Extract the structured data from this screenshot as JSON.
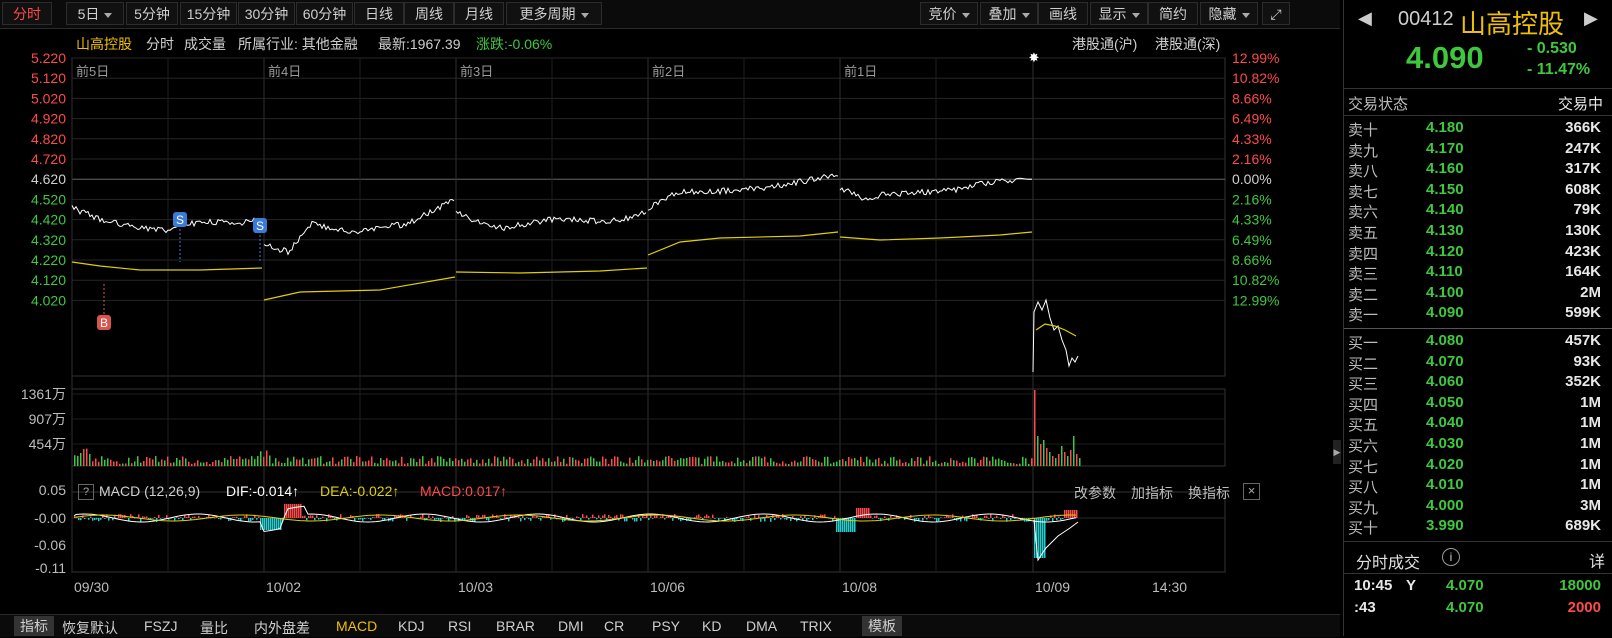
{
  "toolbar": {
    "tabs": [
      {
        "label": "分时",
        "active": true,
        "dropdown": false
      },
      {
        "label": "5日",
        "active": false,
        "dropdown": true
      },
      {
        "label": "5分钟",
        "active": false,
        "dropdown": false
      },
      {
        "label": "15分钟",
        "active": false,
        "dropdown": false
      },
      {
        "label": "30分钟",
        "active": false,
        "dropdown": false
      },
      {
        "label": "60分钟",
        "active": false,
        "dropdown": false
      },
      {
        "label": "日线",
        "active": false,
        "dropdown": false
      },
      {
        "label": "周线",
        "active": false,
        "dropdown": false
      },
      {
        "label": "月线",
        "active": false,
        "dropdown": false
      },
      {
        "label": "更多周期",
        "active": false,
        "dropdown": true
      }
    ],
    "right_buttons": [
      {
        "label": "竞价",
        "dropdown": true
      },
      {
        "label": "叠加",
        "dropdown": true
      },
      {
        "label": "画线",
        "dropdown": false
      },
      {
        "label": "显示",
        "dropdown": true
      },
      {
        "label": "简约",
        "dropdown": false
      },
      {
        "label": "隐藏",
        "dropdown": true
      }
    ],
    "fullscreen_icon": "expand-icon"
  },
  "info_bar": {
    "name": "山高控股",
    "mode": "分时",
    "volume_label": "成交量",
    "industry": "所属行业: 其他金融",
    "latest": "最新:1967.39",
    "change": "涨跌:-0.06%",
    "connect_sh": "港股通(沪)",
    "connect_sz": "港股通(深)"
  },
  "price_axis": {
    "left": [
      "5.220",
      "5.120",
      "5.020",
      "4.920",
      "4.820",
      "4.720",
      "4.620",
      "4.520",
      "4.420",
      "4.320",
      "4.220",
      "4.120",
      "4.020"
    ],
    "right": [
      "12.99%",
      "10.82%",
      "8.66%",
      "6.49%",
      "4.33%",
      "2.16%",
      "0.00%",
      "2.16%",
      "4.33%",
      "6.49%",
      "8.66%",
      "10.82%",
      "12.99%"
    ]
  },
  "day_labels": [
    "前5日",
    "前4日",
    "前3日",
    "前2日",
    "前1日"
  ],
  "volume_axis": [
    "1361万",
    "907万",
    "454万"
  ],
  "macd": {
    "help": "?",
    "title": "MACD (12,26,9)",
    "dif": "DIF:-0.014↑",
    "dea": "DEA:-0.022↑",
    "macd": "MACD:0.017↑",
    "buttons": [
      "改参数",
      "加指标",
      "换指标"
    ],
    "close": "×",
    "axis": [
      "0.05",
      "-0.00",
      "-0.06",
      "-0.11"
    ]
  },
  "time_axis": [
    "09/30",
    "10/02",
    "10/03",
    "10/06",
    "10/08",
    "10/09",
    "14:30"
  ],
  "markers": [
    {
      "label": "S",
      "color": "#3b7bd8"
    },
    {
      "label": "S",
      "color": "#3b7bd8"
    },
    {
      "label": "B",
      "color": "#d9534f"
    }
  ],
  "bottom_tabs": [
    "指标",
    "恢复默认",
    "FSZJ",
    "量比",
    "内外盘差",
    "MACD",
    "KDJ",
    "RSI",
    "BRAR",
    "DMI",
    "CR",
    "PSY",
    "KD",
    "DMA",
    "TRIX",
    "模板"
  ],
  "bottom_active": "MACD",
  "quote": {
    "code": "00412",
    "name": "山高控股",
    "price": "4.090",
    "change": "- 0.530",
    "change_pct": "- 11.47%",
    "status_label": "交易状态",
    "status_value": "交易中",
    "asks": [
      {
        "label": "卖十",
        "price": "4.180",
        "vol": "366K"
      },
      {
        "label": "卖九",
        "price": "4.170",
        "vol": "247K"
      },
      {
        "label": "卖八",
        "price": "4.160",
        "vol": "317K"
      },
      {
        "label": "卖七",
        "price": "4.150",
        "vol": "608K"
      },
      {
        "label": "卖六",
        "price": "4.140",
        "vol": "79K"
      },
      {
        "label": "卖五",
        "price": "4.130",
        "vol": "130K"
      },
      {
        "label": "卖四",
        "price": "4.120",
        "vol": "423K"
      },
      {
        "label": "卖三",
        "price": "4.110",
        "vol": "164K"
      },
      {
        "label": "卖二",
        "price": "4.100",
        "vol": "2M"
      },
      {
        "label": "卖一",
        "price": "4.090",
        "vol": "599K"
      }
    ],
    "bids": [
      {
        "label": "买一",
        "price": "4.080",
        "vol": "457K"
      },
      {
        "label": "买二",
        "price": "4.070",
        "vol": "93K"
      },
      {
        "label": "买三",
        "price": "4.060",
        "vol": "352K"
      },
      {
        "label": "买四",
        "price": "4.050",
        "vol": "1M"
      },
      {
        "label": "买五",
        "price": "4.040",
        "vol": "1M"
      },
      {
        "label": "买六",
        "price": "4.030",
        "vol": "1M"
      },
      {
        "label": "买七",
        "price": "4.020",
        "vol": "1M"
      },
      {
        "label": "买八",
        "price": "4.010",
        "vol": "1M"
      },
      {
        "label": "买九",
        "price": "4.000",
        "vol": "3M"
      },
      {
        "label": "买十",
        "price": "3.990",
        "vol": "689K"
      }
    ],
    "trades_title": "分时成交",
    "trades_detail": "详",
    "trades": [
      {
        "time": "10:45",
        "side": "Y",
        "price": "4.070",
        "vol": "18000",
        "volColor": "#3ec83e"
      },
      {
        "time": ":43",
        "side": "",
        "price": "4.070",
        "vol": "2000",
        "volColor": "#ff4a4a"
      }
    ]
  },
  "colors": {
    "up": "#ff4a4a",
    "down": "#3ec83e",
    "price_line": "#ffffff",
    "avg_line": "#e0d000",
    "accent": "#f0c000"
  }
}
